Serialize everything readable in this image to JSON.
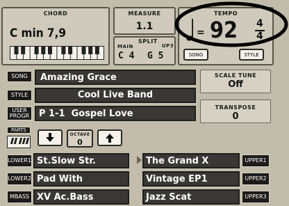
{
  "chord": {
    "caption": "CHORD",
    "value": "C min 7,9"
  },
  "measure": {
    "caption": "MEASURE",
    "value": "1.1"
  },
  "split": {
    "main_caption": "MAIN",
    "split_caption": "SPLIT",
    "up3_caption": "UP3",
    "main_value": "C 4",
    "up3_value": "G 5"
  },
  "tempo": {
    "caption": "TEMPO",
    "eq": "=",
    "value": "92",
    "sig_top": "4",
    "sig_bottom": "4",
    "song_btn": "SONG",
    "style_btn": "STYLE"
  },
  "song": {
    "tag": "SONG",
    "value": "Amazing Grace"
  },
  "style": {
    "tag": "STYLE",
    "value": "Cool Live Band"
  },
  "user_program": {
    "tag_line1": "USER",
    "tag_line2": "PROGR",
    "value": "P 1-1  Gospel Love"
  },
  "scale_tune": {
    "caption_line1": "SCALE TUNE",
    "value": "Off"
  },
  "transpose": {
    "caption": "TRANSPOSE",
    "value": "0"
  },
  "parts": {
    "caption": "PARTS",
    "octave_caption": "OCTAVE",
    "octave_value": "0"
  },
  "left_parts": [
    {
      "tag": "LOWER1",
      "value": "St.Slow Str."
    },
    {
      "tag": "LOWER2",
      "value": "Pad With"
    },
    {
      "tag": "MBASS",
      "value": "XV Ac.Bass"
    }
  ],
  "right_parts": [
    {
      "tag": "UPPER1",
      "value": "The Grand X"
    },
    {
      "tag": "UPPER2",
      "value": "Vintage EP1"
    },
    {
      "tag": "UPPER3",
      "value": "Jazz Scat"
    }
  ],
  "colors": {
    "background": "#c2bcab",
    "lcd": "#cfcabb",
    "dark_field": "#3a3835"
  }
}
